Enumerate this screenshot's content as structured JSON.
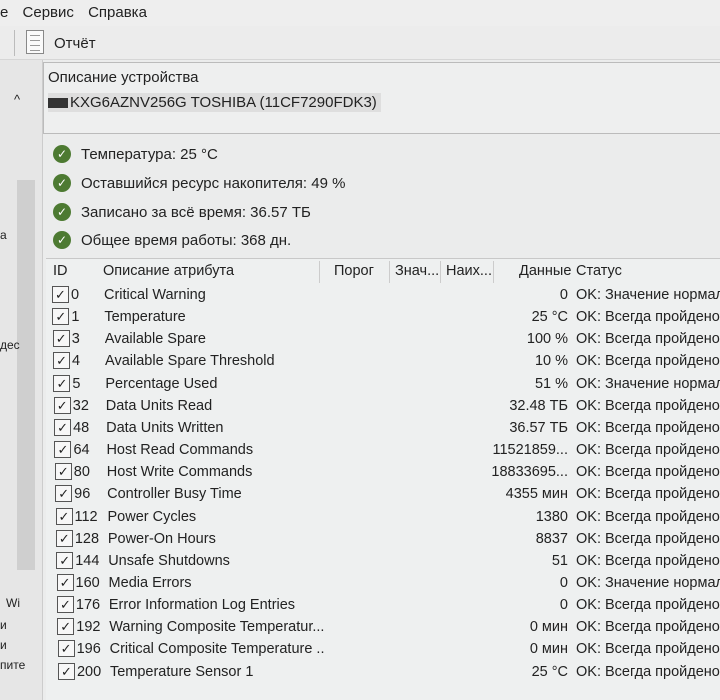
{
  "menu": [
    "е",
    "Сервис",
    "Справка"
  ],
  "toolbar": {
    "report_label": "Отчёт"
  },
  "sidebar": {
    "frag": [
      "а",
      "дес",
      "Wi",
      "и",
      "и",
      "пите"
    ]
  },
  "device": {
    "title": "Описание устройства",
    "model": "KXG6AZNV256G TOSHIBA (11CF7290FDK3)"
  },
  "health": [
    "Температура: 25 °C",
    "Оставшийся ресурс накопителя: 49 %",
    "Записано за всё время: 36.57 ТБ",
    "Общее время работы: 368 дн."
  ],
  "columns": {
    "id": "ID",
    "desc": "Описание атрибута",
    "threshold": "Порог",
    "value": "Знач...",
    "worst": "Наих...",
    "data": "Данные",
    "status": "Статус"
  },
  "rows": [
    {
      "id": "0",
      "name": "Critical Warning",
      "data": "0",
      "status": "OK: Значение нормальное"
    },
    {
      "id": "1",
      "name": "Temperature",
      "data": "25 °C",
      "status": "OK: Всегда пройдено"
    },
    {
      "id": "3",
      "name": "Available Spare",
      "data": "100 %",
      "status": "OK: Всегда пройдено"
    },
    {
      "id": "4",
      "name": "Available Spare Threshold",
      "data": "10 %",
      "status": "OK: Всегда пройдено"
    },
    {
      "id": "5",
      "name": "Percentage Used",
      "data": "51 %",
      "status": "OK: Значение нормальное"
    },
    {
      "id": "32",
      "name": "Data Units Read",
      "data": "32.48 ТБ",
      "status": "OK: Всегда пройдено"
    },
    {
      "id": "48",
      "name": "Data Units Written",
      "data": "36.57 ТБ",
      "status": "OK: Всегда пройдено"
    },
    {
      "id": "64",
      "name": "Host Read Commands",
      "data": "11521859...",
      "status": "OK: Всегда пройдено"
    },
    {
      "id": "80",
      "name": "Host Write Commands",
      "data": "18833695...",
      "status": "OK: Всегда пройдено"
    },
    {
      "id": "96",
      "name": "Controller Busy Time",
      "data": "4355 мин",
      "status": "OK: Всегда пройдено"
    },
    {
      "id": "112",
      "name": "Power Cycles",
      "data": "1380",
      "status": "OK: Всегда пройдено"
    },
    {
      "id": "128",
      "name": "Power-On Hours",
      "data": "8837",
      "status": "OK: Всегда пройдено"
    },
    {
      "id": "144",
      "name": "Unsafe Shutdowns",
      "data": "51",
      "status": "OK: Всегда пройдено"
    },
    {
      "id": "160",
      "name": "Media Errors",
      "data": "0",
      "status": "OK: Значение нормальное"
    },
    {
      "id": "176",
      "name": "Error Information Log Entries",
      "data": "0",
      "status": "OK: Всегда пройдено"
    },
    {
      "id": "192",
      "name": "Warning Composite Temperatur...",
      "data": "0 мин",
      "status": "OK: Всегда пройдено"
    },
    {
      "id": "196",
      "name": "Critical Composite Temperature ...",
      "data": "0 мин",
      "status": "OK: Всегда пройдено"
    },
    {
      "id": "200",
      "name": "Temperature Sensor 1",
      "data": "25 °C",
      "status": "OK: Всегда пройдено"
    }
  ]
}
